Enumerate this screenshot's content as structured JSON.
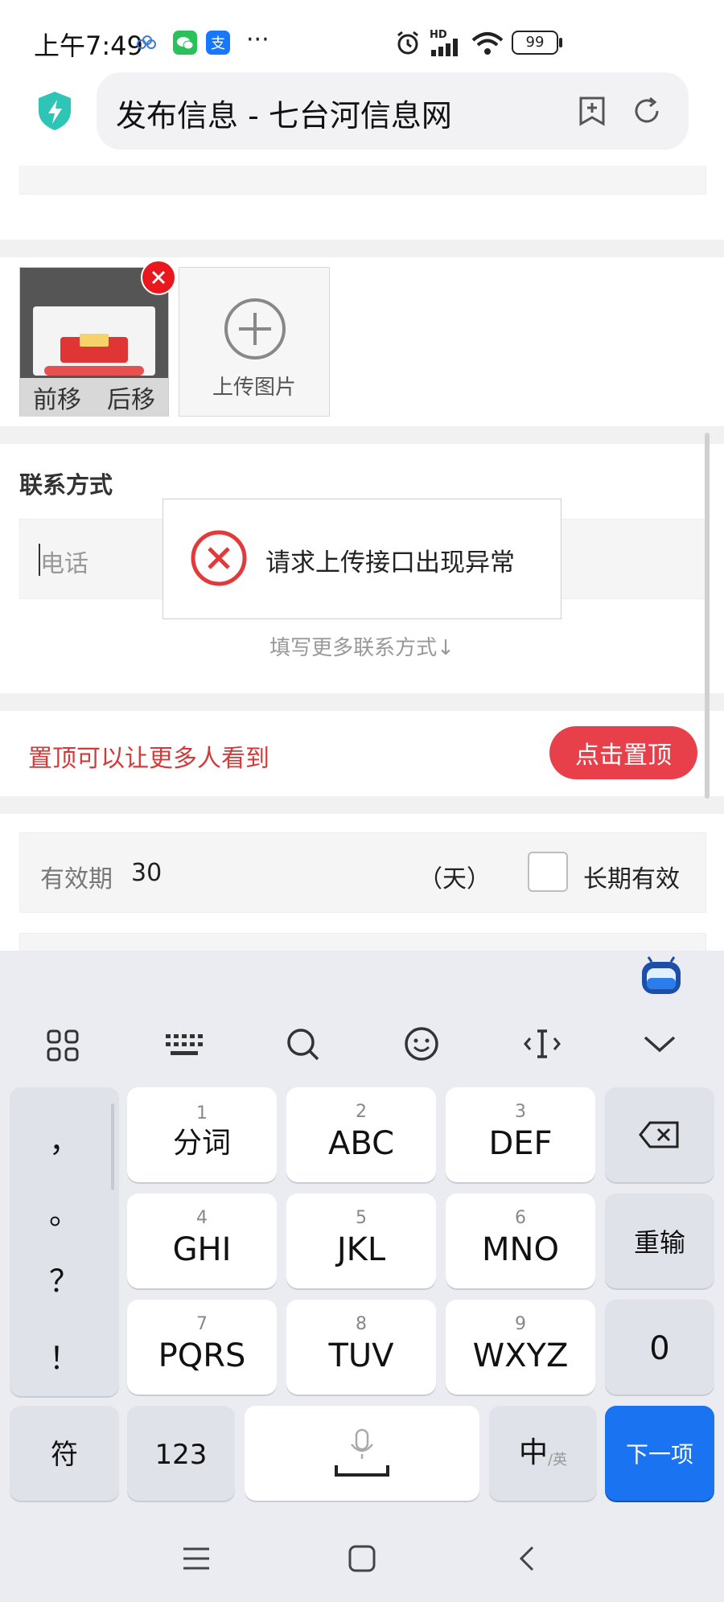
{
  "status_bar": {
    "time": "上午7:49",
    "more": "···",
    "network": "HD",
    "battery": "99"
  },
  "browser": {
    "page_title": "发布信息 - 七台河信息网"
  },
  "photos": {
    "move_forward": "前移",
    "move_back": "后移",
    "upload_label": "上传图片"
  },
  "contact": {
    "section_title": "联系方式",
    "phone_placeholder": "电话",
    "more_contacts": "填写更多联系方式↓"
  },
  "toast": {
    "message": "请求上传接口出现异常"
  },
  "promote": {
    "text": "置顶可以让更多人看到",
    "button": "点击置顶"
  },
  "validity": {
    "label": "有效期",
    "value": "30",
    "unit": "（天）",
    "long_term_label": "长期有效",
    "long_term_checked": false
  },
  "keyboard": {
    "punctuation": [
      "，",
      "。",
      "？",
      "！"
    ],
    "keys": [
      {
        "num": "1",
        "label": "分词"
      },
      {
        "num": "2",
        "label": "ABC"
      },
      {
        "num": "3",
        "label": "DEF"
      },
      {
        "num": "4",
        "label": "GHI"
      },
      {
        "num": "5",
        "label": "JKL"
      },
      {
        "num": "6",
        "label": "MNO"
      },
      {
        "num": "7",
        "label": "PQRS"
      },
      {
        "num": "8",
        "label": "TUV"
      },
      {
        "num": "9",
        "label": "WXYZ"
      }
    ],
    "reenter": "重输",
    "zero": "0",
    "symbols": "符",
    "numbers": "123",
    "lang_main": "中",
    "lang_alt": "/英",
    "next": "下一项"
  },
  "colors": {
    "accent_red": "#e8404a",
    "promo_text": "#d33a3a",
    "next_key": "#1a73f0"
  }
}
